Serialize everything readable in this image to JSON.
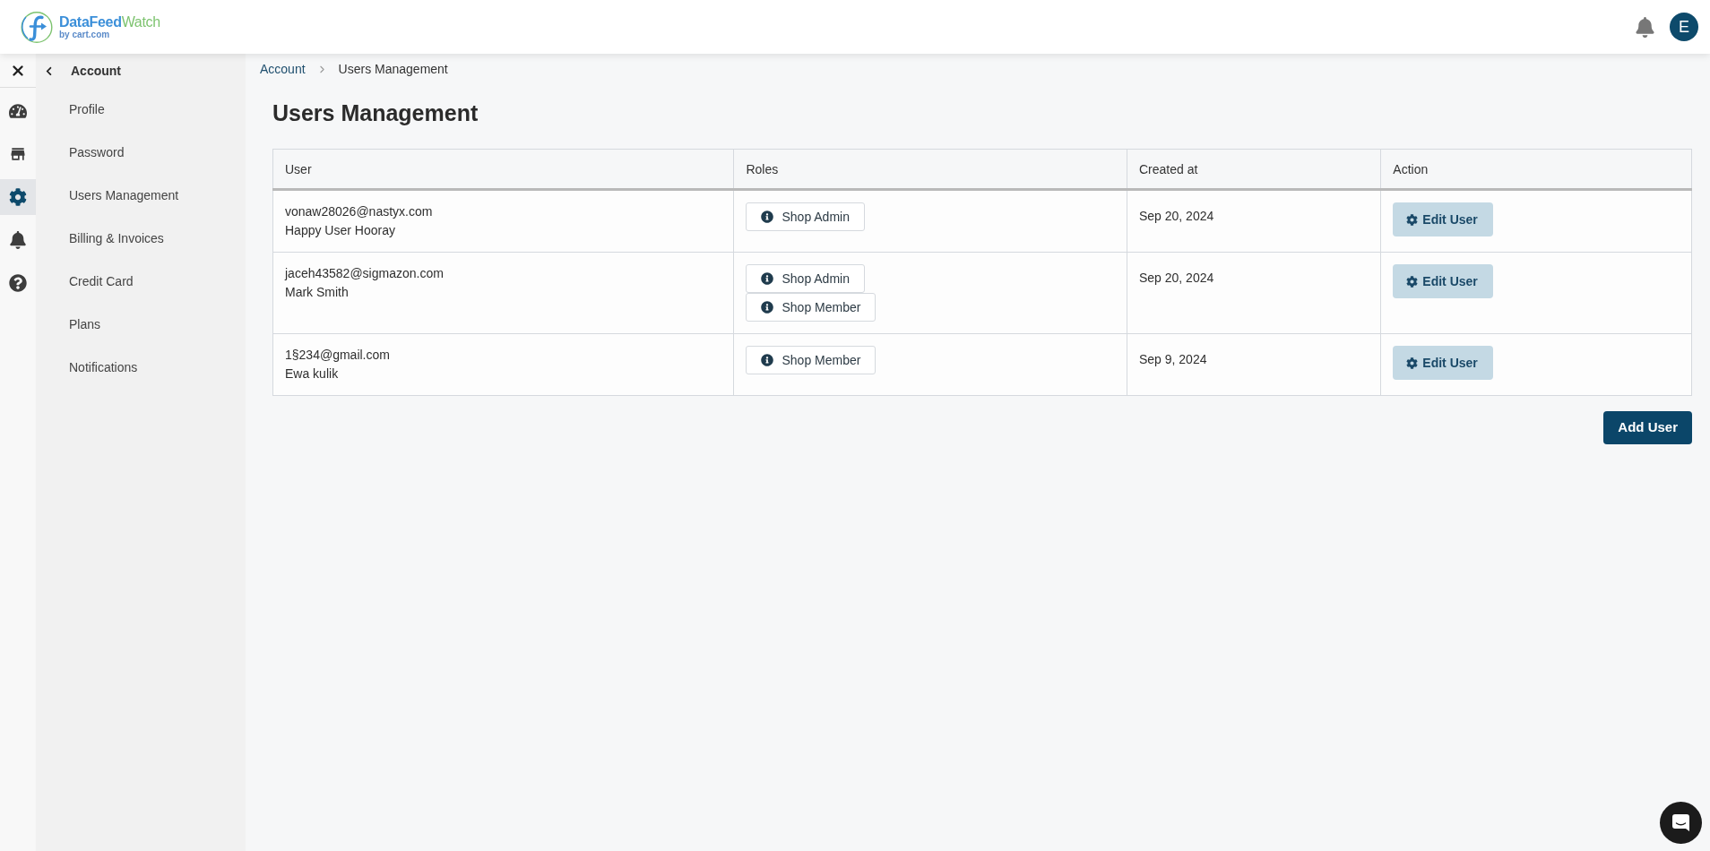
{
  "header": {
    "logo": {
      "brand": "DataFeed",
      "brand_accent": "Watch",
      "tagline": "by cart.com"
    },
    "avatar": {
      "initial": "E"
    }
  },
  "rail": {
    "items": [
      {
        "kind": "dashboard",
        "selected": false
      },
      {
        "kind": "store",
        "selected": false
      },
      {
        "kind": "settings",
        "selected": true
      },
      {
        "kind": "notifications",
        "selected": false
      },
      {
        "kind": "help",
        "selected": false
      }
    ]
  },
  "sidebar": {
    "title": "Account",
    "items": [
      "Profile",
      "Password",
      "Users Management",
      "Billing & Invoices",
      "Credit Card",
      "Plans",
      "Notifications"
    ]
  },
  "breadcrumb": {
    "links": [
      "Account"
    ],
    "current": "Users Management"
  },
  "page_title": "Users Management",
  "table": {
    "columns": [
      "User",
      "Roles",
      "Created at",
      "Action"
    ],
    "rows": [
      {
        "email": "vonaw28026@nastyx.com",
        "name": "Happy User Hooray",
        "roles": [
          "Shop Admin"
        ],
        "created_at": "Sep 20, 2024",
        "action": "Edit User"
      },
      {
        "email": "jaceh43582@sigmazon.com",
        "name": "Mark Smith",
        "roles": [
          "Shop Admin",
          "Shop Member"
        ],
        "created_at": "Sep 20, 2024",
        "action": "Edit User"
      },
      {
        "email": "1§234@gmail.com",
        "name": "Ewa kulik",
        "roles": [
          "Shop Member"
        ],
        "created_at": "Sep 9, 2024",
        "action": "Edit User"
      }
    ]
  },
  "add_button": "Add User"
}
